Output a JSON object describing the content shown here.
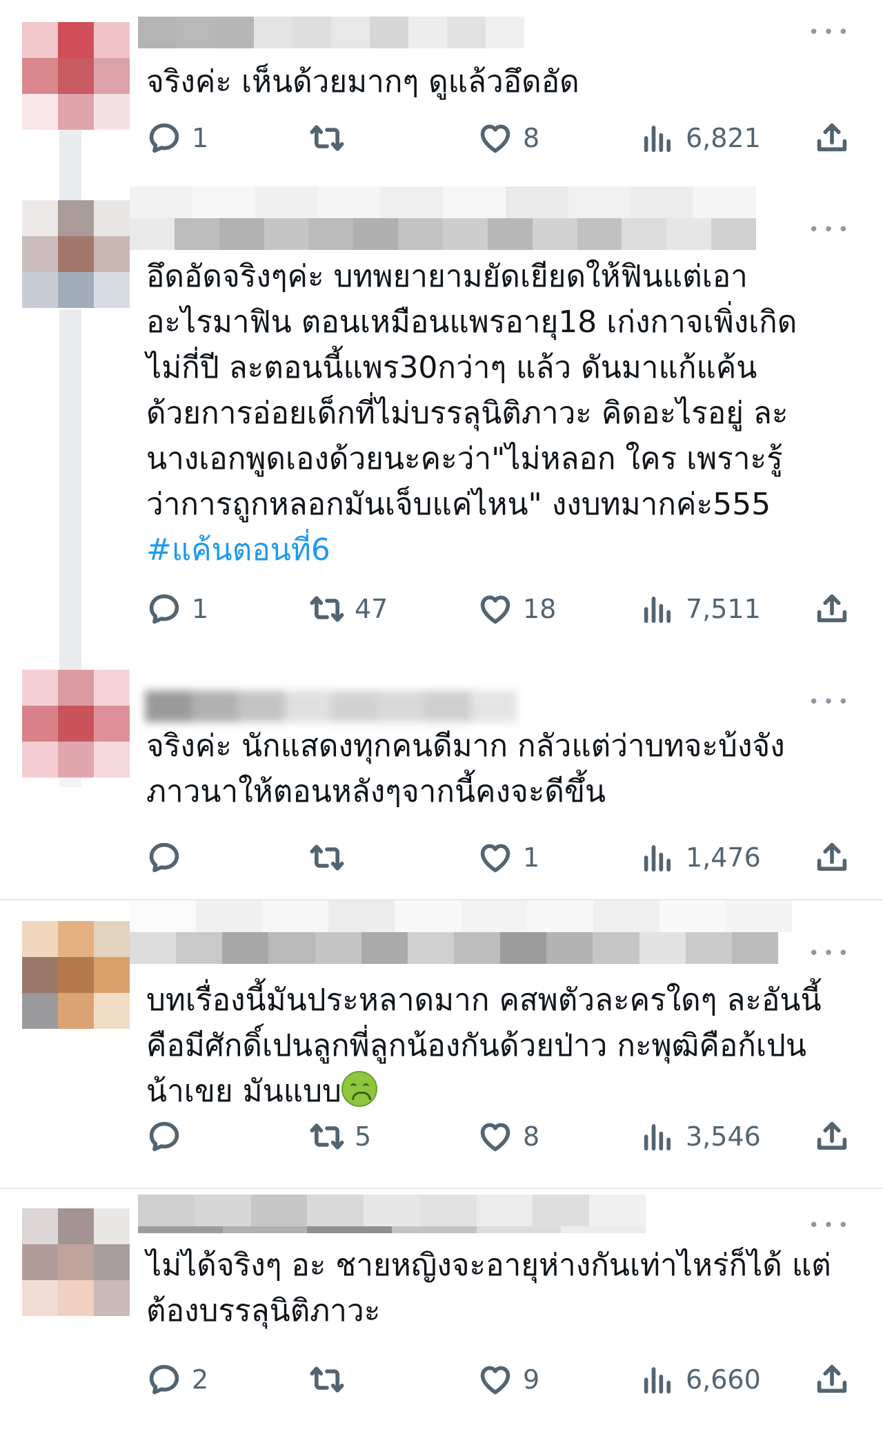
{
  "tweets": [
    {
      "lines": [
        "จริงค่ะ เห็นด้วยมากๆ ดูแล้วอึดอัด"
      ],
      "reply_count": "1",
      "retweet_count": "",
      "like_count": "8",
      "view_count": "6,821"
    },
    {
      "lines": [
        "อึดอัดจริงๆค่ะ บทพยายามยัดเยียดให้ฟินแต่เอา",
        "อะไรมาฟิน ตอนเหมือนแพรอายุ18 เก่งกาจเพิ่งเกิด",
        "ไม่กี่ปี ละตอนนี้แพร30กว่าๆ แล้ว ดันมาแก้แค้น",
        "ด้วยการอ่อยเด็กที่ไม่บรรลุนิติภาวะ คิดอะไรอยู่ ละ",
        "นางเอกพูดเองด้วยนะคะว่า\"ไม่หลอก ใคร เพราะรู้",
        "ว่าการถูกหลอกมันเจ็บแค่ไหน\" งงบทมากค่ะ555"
      ],
      "hashtag": "#แค้นตอนที่6",
      "reply_count": "1",
      "retweet_count": "47",
      "like_count": "18",
      "view_count": "7,511"
    },
    {
      "lines": [
        "จริงค่ะ นักแสดงทุกคนดีมาก กลัวแต่ว่าบทจะบ้งจัง",
        "ภาวนาให้ตอนหลังๆจากนี้คงจะดีขึ้น"
      ],
      "reply_count": "",
      "retweet_count": "",
      "like_count": "1",
      "view_count": "1,476"
    },
    {
      "lines": [
        "บทเรื่องนี้มันประหลาดมาก คสพตัวละครใดๆ ละอันนี้",
        "คือมีศักดิ์เปนลูกพี่ลูกน้องกันด้วยป่าว กะพุฒิคือก้เปน",
        "น้าเขย มันแบบ"
      ],
      "emoji": "nauseated-face-icon",
      "reply_count": "",
      "retweet_count": "5",
      "like_count": "8",
      "view_count": "3,546"
    },
    {
      "lines": [
        "ไม่ได้จริงๆ อะ ชายหญิงจะอายุห่างกันเท่าไหร่ก็ได้ แต่",
        "ต้องบรรลุนิติภาวะ"
      ],
      "reply_count": "2",
      "retweet_count": "",
      "like_count": "9",
      "view_count": "6,660"
    }
  ],
  "more_label": "•••",
  "colors": {
    "text": "#0f1419",
    "muted": "#536471",
    "link": "#1d9bf0",
    "divider": "#e6e8eb"
  },
  "icons": [
    "reply-icon",
    "retweet-icon",
    "like-icon",
    "views-icon",
    "share-icon",
    "more-icon"
  ]
}
